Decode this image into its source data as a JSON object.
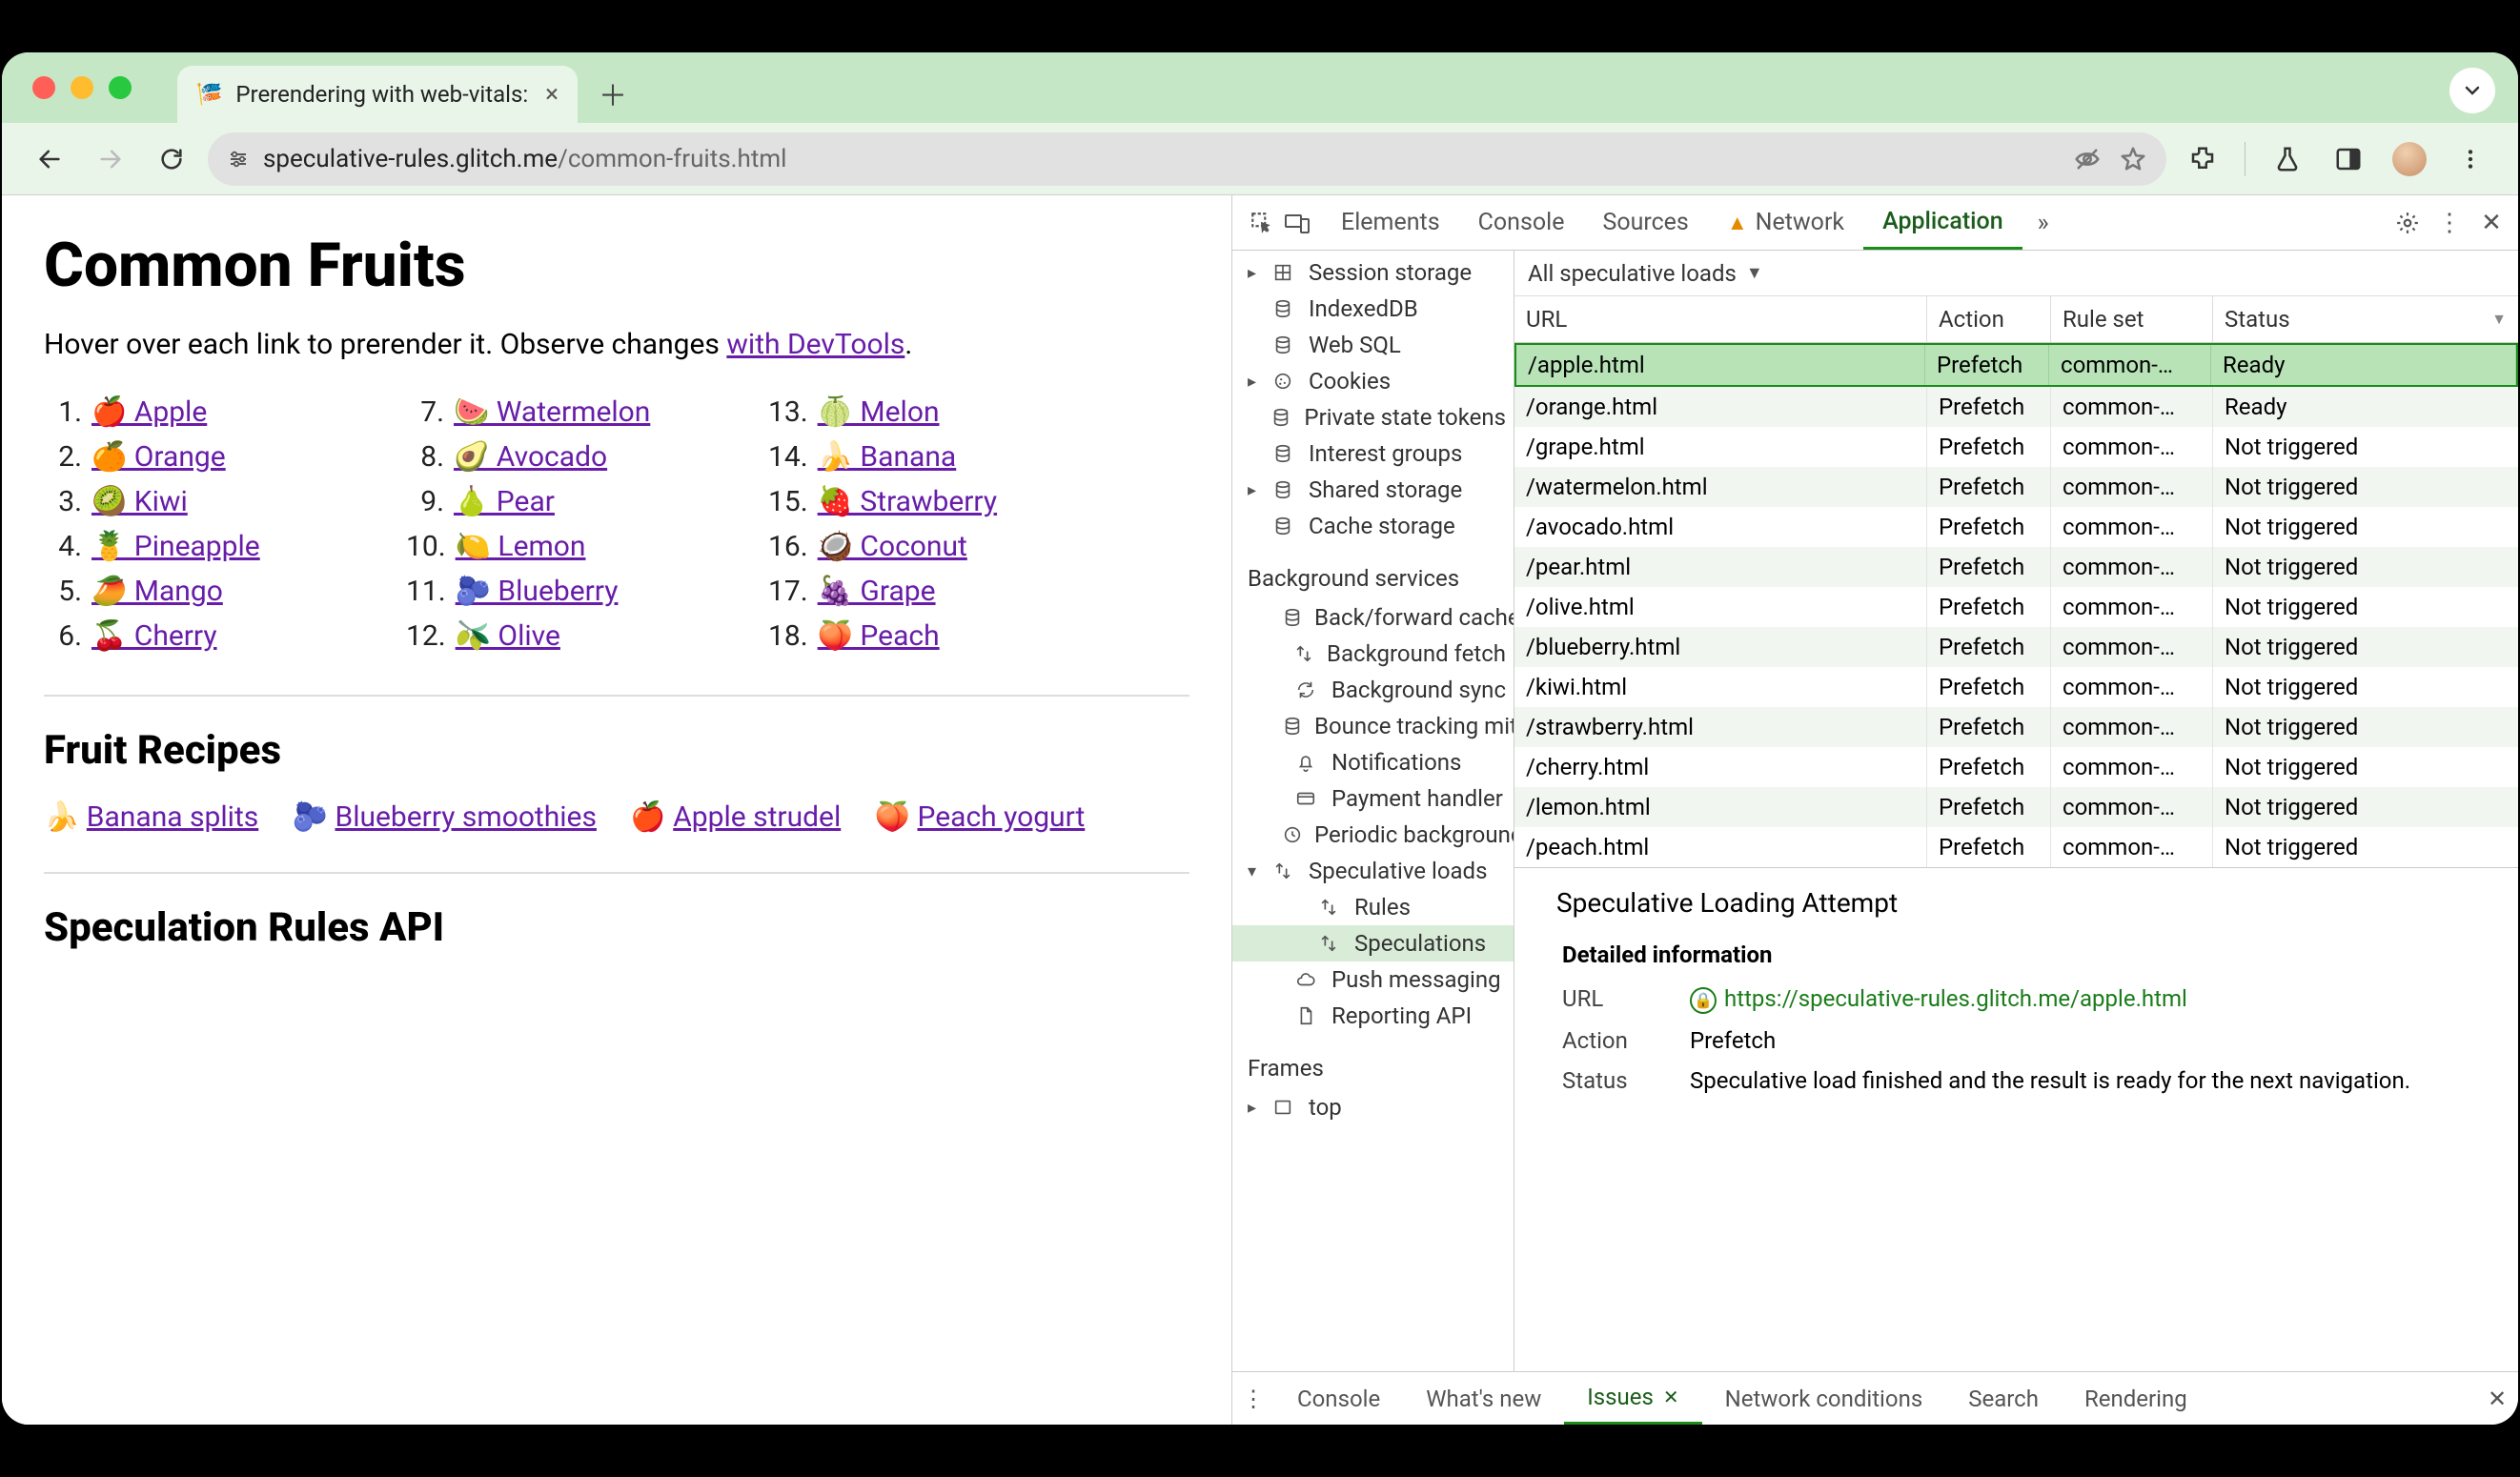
{
  "browser": {
    "tab_title": "Prerendering with web-vitals:",
    "url_host": "speculative-rules.glitch.me",
    "url_path": "/common-fruits.html"
  },
  "page": {
    "h1": "Common Fruits",
    "intro_pre": "Hover over each link to prerender it. Observe changes ",
    "intro_link": "with DevTools",
    "intro_post": ".",
    "fruits_col1": [
      {
        "n": "1.",
        "emoji": "🍎",
        "label": "Apple"
      },
      {
        "n": "2.",
        "emoji": "🍊",
        "label": "Orange"
      },
      {
        "n": "3.",
        "emoji": "🥝",
        "label": "Kiwi"
      },
      {
        "n": "4.",
        "emoji": "🍍",
        "label": "Pineapple"
      },
      {
        "n": "5.",
        "emoji": "🥭",
        "label": "Mango"
      },
      {
        "n": "6.",
        "emoji": "🍒",
        "label": "Cherry"
      }
    ],
    "fruits_col2": [
      {
        "n": "7.",
        "emoji": "🍉",
        "label": "Watermelon"
      },
      {
        "n": "8.",
        "emoji": "🥑",
        "label": "Avocado"
      },
      {
        "n": "9.",
        "emoji": "🍐",
        "label": "Pear"
      },
      {
        "n": "10.",
        "emoji": "🍋",
        "label": "Lemon"
      },
      {
        "n": "11.",
        "emoji": "🫐",
        "label": "Blueberry"
      },
      {
        "n": "12.",
        "emoji": "🫒",
        "label": "Olive"
      }
    ],
    "fruits_col3": [
      {
        "n": "13.",
        "emoji": "🍈",
        "label": "Melon"
      },
      {
        "n": "14.",
        "emoji": "🍌",
        "label": "Banana"
      },
      {
        "n": "15.",
        "emoji": "🍓",
        "label": "Strawberry"
      },
      {
        "n": "16.",
        "emoji": "🥥",
        "label": "Coconut"
      },
      {
        "n": "17.",
        "emoji": "🍇",
        "label": "Grape"
      },
      {
        "n": "18.",
        "emoji": "🍑",
        "label": "Peach"
      }
    ],
    "h2_recipes": "Fruit Recipes",
    "recipes": [
      {
        "emoji": "🍌",
        "label": "Banana splits"
      },
      {
        "emoji": "🫐",
        "label": "Blueberry smoothies"
      },
      {
        "emoji": "🍎",
        "label": "Apple strudel"
      },
      {
        "emoji": "🍑",
        "label": "Peach yogurt"
      }
    ],
    "h2_api": "Speculation Rules API"
  },
  "devtools": {
    "tabs": {
      "elements": "Elements",
      "console": "Console",
      "sources": "Sources",
      "network": "Network",
      "application": "Application"
    },
    "side": {
      "storage": [
        {
          "label": "Session storage",
          "icon": "grid",
          "caret": true
        },
        {
          "label": "IndexedDB",
          "icon": "db"
        },
        {
          "label": "Web SQL",
          "icon": "db"
        },
        {
          "label": "Cookies",
          "icon": "cookie",
          "caret": true
        },
        {
          "label": "Private state tokens",
          "icon": "db"
        },
        {
          "label": "Interest groups",
          "icon": "db"
        },
        {
          "label": "Shared storage",
          "icon": "db",
          "caret": true
        },
        {
          "label": "Cache storage",
          "icon": "db"
        }
      ],
      "bg_head": "Background services",
      "bg": [
        {
          "label": "Back/forward cache",
          "icon": "db"
        },
        {
          "label": "Background fetch",
          "icon": "updown"
        },
        {
          "label": "Background sync",
          "icon": "sync"
        },
        {
          "label": "Bounce tracking mitigation",
          "icon": "db"
        },
        {
          "label": "Notifications",
          "icon": "bell"
        },
        {
          "label": "Payment handler",
          "icon": "card"
        },
        {
          "label": "Periodic background sync",
          "icon": "clock"
        }
      ],
      "spec_parent": "Speculative loads",
      "spec_children": [
        {
          "label": "Rules",
          "icon": "updown"
        },
        {
          "label": "Speculations",
          "icon": "updown",
          "selected": true
        }
      ],
      "after": [
        {
          "label": "Push messaging",
          "icon": "cloud"
        },
        {
          "label": "Reporting API",
          "icon": "doc"
        }
      ],
      "frames_head": "Frames",
      "frames": [
        {
          "label": "top",
          "icon": "frame",
          "caret": true
        }
      ]
    },
    "filter_label": "All speculative loads",
    "columns": {
      "url": "URL",
      "action": "Action",
      "ruleset": "Rule set",
      "status": "Status"
    },
    "rows": [
      {
        "url": "/apple.html",
        "action": "Prefetch",
        "ruleset": "common-…",
        "status": "Ready",
        "selected": true
      },
      {
        "url": "/orange.html",
        "action": "Prefetch",
        "ruleset": "common-…",
        "status": "Ready"
      },
      {
        "url": "/grape.html",
        "action": "Prefetch",
        "ruleset": "common-…",
        "status": "Not triggered"
      },
      {
        "url": "/watermelon.html",
        "action": "Prefetch",
        "ruleset": "common-…",
        "status": "Not triggered"
      },
      {
        "url": "/avocado.html",
        "action": "Prefetch",
        "ruleset": "common-…",
        "status": "Not triggered"
      },
      {
        "url": "/pear.html",
        "action": "Prefetch",
        "ruleset": "common-…",
        "status": "Not triggered"
      },
      {
        "url": "/olive.html",
        "action": "Prefetch",
        "ruleset": "common-…",
        "status": "Not triggered"
      },
      {
        "url": "/blueberry.html",
        "action": "Prefetch",
        "ruleset": "common-…",
        "status": "Not triggered"
      },
      {
        "url": "/kiwi.html",
        "action": "Prefetch",
        "ruleset": "common-…",
        "status": "Not triggered"
      },
      {
        "url": "/strawberry.html",
        "action": "Prefetch",
        "ruleset": "common-…",
        "status": "Not triggered"
      },
      {
        "url": "/cherry.html",
        "action": "Prefetch",
        "ruleset": "common-…",
        "status": "Not triggered"
      },
      {
        "url": "/lemon.html",
        "action": "Prefetch",
        "ruleset": "common-…",
        "status": "Not triggered"
      },
      {
        "url": "/peach.html",
        "action": "Prefetch",
        "ruleset": "common-…",
        "status": "Not triggered"
      }
    ],
    "detail": {
      "title": "Speculative Loading Attempt",
      "section": "Detailed information",
      "url_label": "URL",
      "url_value": "https://speculative-rules.glitch.me/apple.html",
      "action_label": "Action",
      "action_value": "Prefetch",
      "status_label": "Status",
      "status_value": "Speculative load finished and the result is ready for the next navigation."
    },
    "drawer": {
      "console": "Console",
      "whatsnew": "What's new",
      "issues": "Issues",
      "netcond": "Network conditions",
      "search": "Search",
      "rendering": "Rendering"
    }
  }
}
